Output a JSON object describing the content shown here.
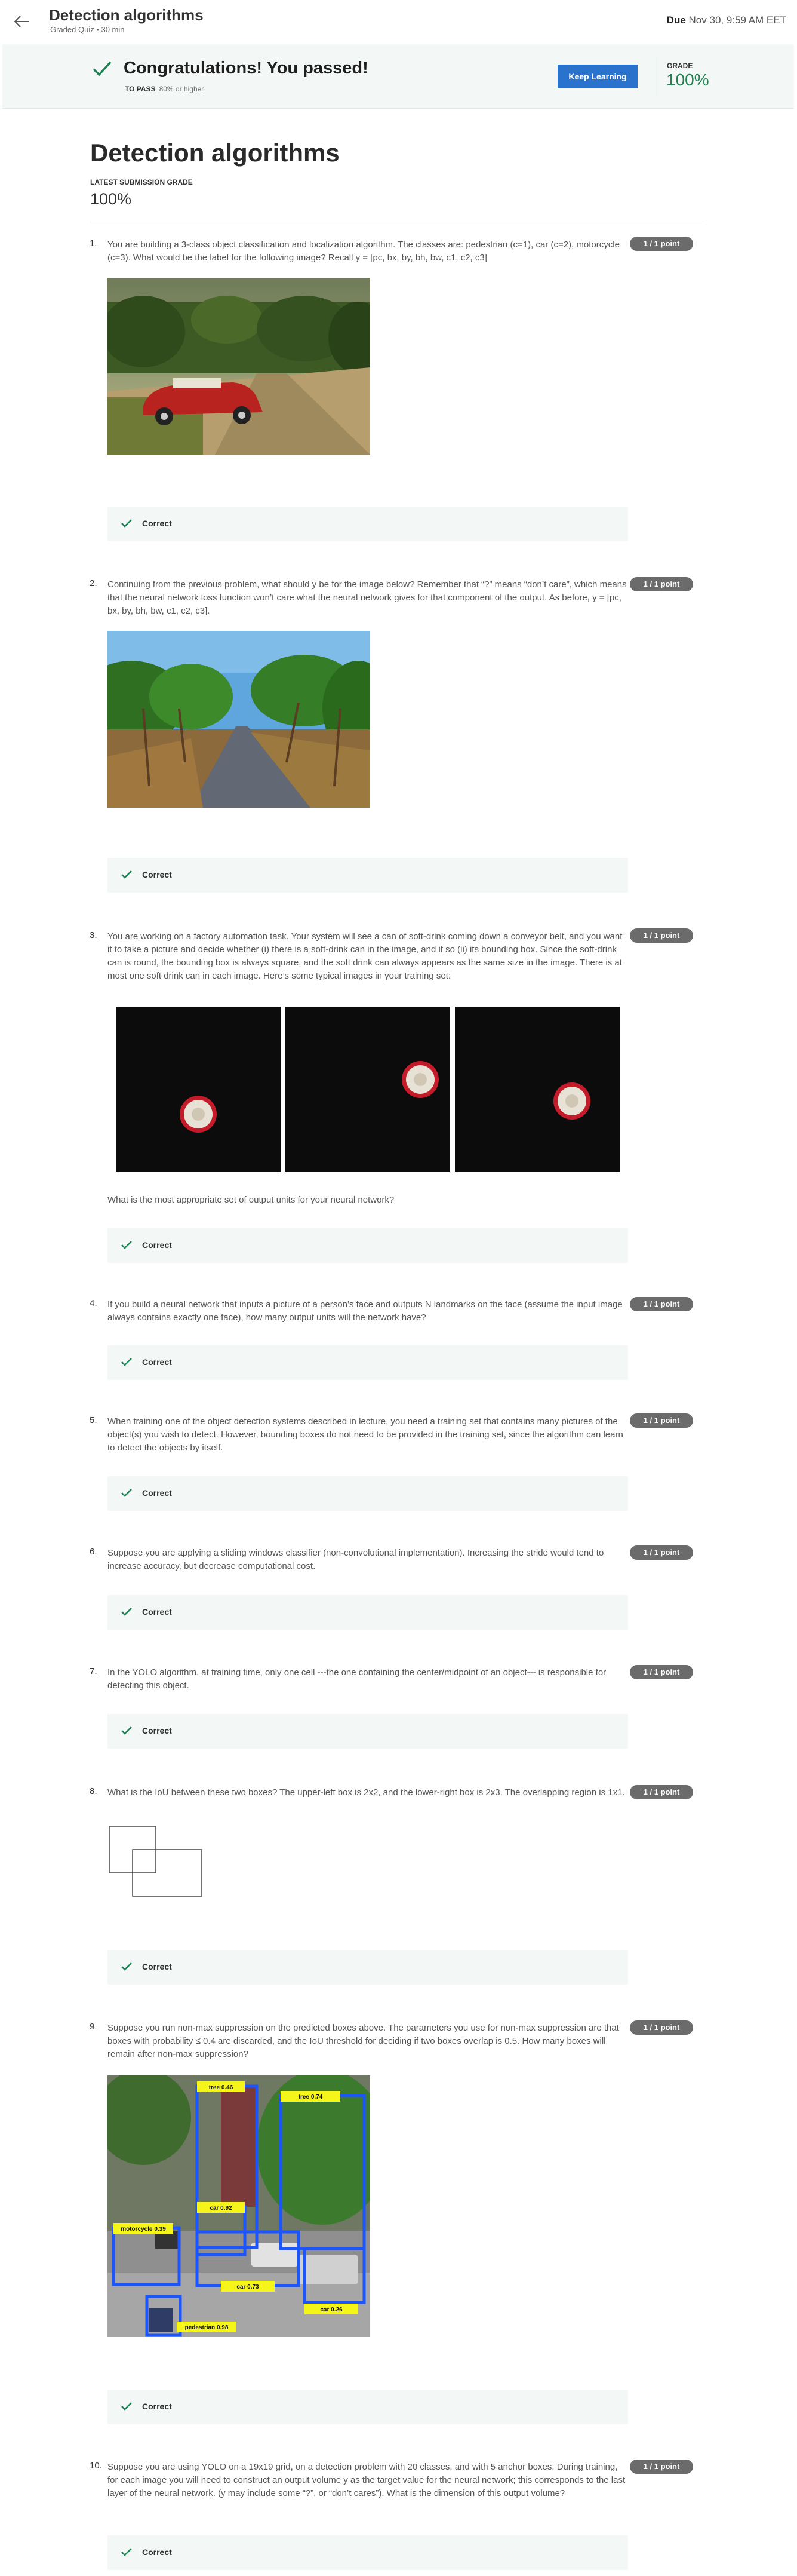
{
  "header": {
    "title": "Detection algorithms",
    "subtitle": "Graded Quiz • 30 min",
    "due_label": "Due",
    "due_value": "Nov 30, 9:59 AM EET"
  },
  "banner": {
    "title": "Congratulations! You passed!",
    "to_pass_label": "TO PASS",
    "to_pass_value": "80% or higher",
    "button": "Keep Learning",
    "grade_label": "GRADE",
    "grade_value": "100%"
  },
  "main": {
    "title": "Detection algorithms",
    "latest_label": "LATEST SUBMISSION GRADE",
    "latest_value": "100%"
  },
  "feedback_label": "Correct",
  "questions": [
    {
      "num": "1.",
      "points": "1 / 1 point",
      "text": "You are building a 3-class object classification and localization algorithm. The classes are: pedestrian (c=1), car (c=2), motorcycle (c=3). What would be the label for the following image? Recall y = [pc, bx, by, bh, bw, c1, c2, c3]"
    },
    {
      "num": "2.",
      "points": "1 / 1 point",
      "text": "Continuing from the previous problem, what should y be for the image below? Remember that “?” means “don’t care”, which means that the neural network loss function won’t care what the neural network gives for that component of the output. As before, y = [pc, bx, by, bh, bw, c1, c2, c3]."
    },
    {
      "num": "3.",
      "points": "1 / 1 point",
      "text": "You are working on a factory automation task. Your system will see a can of soft-drink coming down a conveyor belt, and you want it to take a picture and decide whether (i) there is a soft-drink can in the image, and if so (ii) its bounding box. Since the soft-drink can is round, the bounding box is always square, and the soft drink can always appears as the same size in the image. There is at most one soft drink can in each image. Here’s some typical images in your training set:",
      "after": "What is the most appropriate set of output units for your neural network?"
    },
    {
      "num": "4.",
      "points": "1 / 1 point",
      "text": "If you build a neural network that inputs a picture of a person’s face and outputs N landmarks on the face (assume the input image always contains exactly one face), how many output units will the network have?"
    },
    {
      "num": "5.",
      "points": "1 / 1 point",
      "text": "When training one of the object detection systems described in lecture, you need a training set that contains many pictures of the object(s) you wish to detect. However, bounding boxes do not need to be provided in the training set, since the algorithm can learn to detect the objects by itself."
    },
    {
      "num": "6.",
      "points": "1 / 1 point",
      "text": "Suppose you are applying a sliding windows classifier (non-convolutional implementation). Increasing the stride would tend to increase accuracy, but decrease computational cost."
    },
    {
      "num": "7.",
      "points": "1 / 1 point",
      "text": "In the YOLO algorithm, at training time, only one cell ---the one containing the center/midpoint of an object--- is responsible for detecting this object."
    },
    {
      "num": "8.",
      "points": "1 / 1 point",
      "text": "What is the IoU between these two boxes? The upper-left box is 2x2, and the lower-right box is 2x3. The overlapping region is 1x1."
    },
    {
      "num": "9.",
      "points": "1 / 1 point",
      "text": "Suppose you run non-max suppression on the predicted boxes above. The parameters you use for non-max suppression are that boxes with probability ≤ 0.4 are discarded, and the IoU threshold for deciding if two boxes overlap is 0.5. How many boxes will remain after non-max suppression?"
    },
    {
      "num": "10.",
      "points": "1 / 1 point",
      "text": "Suppose you are using YOLO on a 19x19 grid, on a detection problem with 20 classes, and with 5 anchor boxes. During training, for each image you will need to construct an output volume y as the target value for the neural network; this corresponds to the last layer of the neural network. (y may include some “?”, or “don’t cares”). What is the dimension of this output volume?"
    }
  ],
  "detections": [
    {
      "label": "tree 0.46"
    },
    {
      "label": "tree 0.74"
    },
    {
      "label": "car 0.92"
    },
    {
      "label": "motorcycle 0.39"
    },
    {
      "label": "car 0.73"
    },
    {
      "label": "car 0.26"
    },
    {
      "label": "pedestrian 0.98"
    }
  ],
  "colors": {
    "accent": "#2a73cc",
    "success": "#1f8354",
    "badge": "#6b6b6b",
    "feedback_bg": "#f3f8f6"
  }
}
